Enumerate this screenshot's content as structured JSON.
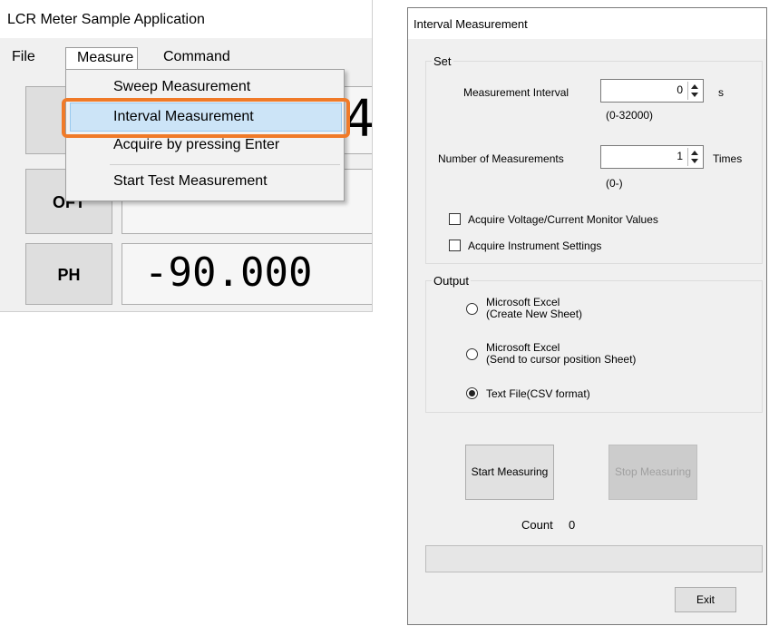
{
  "app": {
    "title": "LCR Meter Sample Application",
    "menu": {
      "file": "File",
      "measure": "Measure",
      "command": "Command"
    },
    "dropdown": {
      "items": [
        "Sweep Measurement",
        "Interval Measurement",
        "Acquire by pressing Enter",
        "Start Test Measurement"
      ],
      "highlighted": "Interval Measurement"
    },
    "buttons": {
      "mid": "OFT",
      "ph": "PH"
    },
    "displays": {
      "top_fragment": "4",
      "ph_value": "-90.000"
    },
    "highlight_color": "#f07a28"
  },
  "dialog": {
    "title": "Interval Measurement",
    "set": {
      "label": "Set",
      "interval_label": "Measurement Interval",
      "interval_value": "0",
      "interval_unit": "s",
      "interval_range": "(0-32000)",
      "count_label": "Number of Measurements",
      "count_value": "1",
      "count_unit": "Times",
      "count_range": "(0-)",
      "chk_voltage": "Acquire Voltage/Current Monitor Values",
      "chk_settings": "Acquire Instrument Settings"
    },
    "output": {
      "label": "Output",
      "opt1_line1": "Microsoft Excel",
      "opt1_line2": "(Create New Sheet)",
      "opt2_line1": "Microsoft Excel",
      "opt2_line2": "(Send to cursor position Sheet)",
      "opt3": "Text File(CSV format)",
      "selected": "Text File(CSV format)"
    },
    "start_label": "Start Measuring",
    "stop_label": "Stop Measuring",
    "count_text": "Count",
    "count_number": "0",
    "exit_label": "Exit"
  }
}
